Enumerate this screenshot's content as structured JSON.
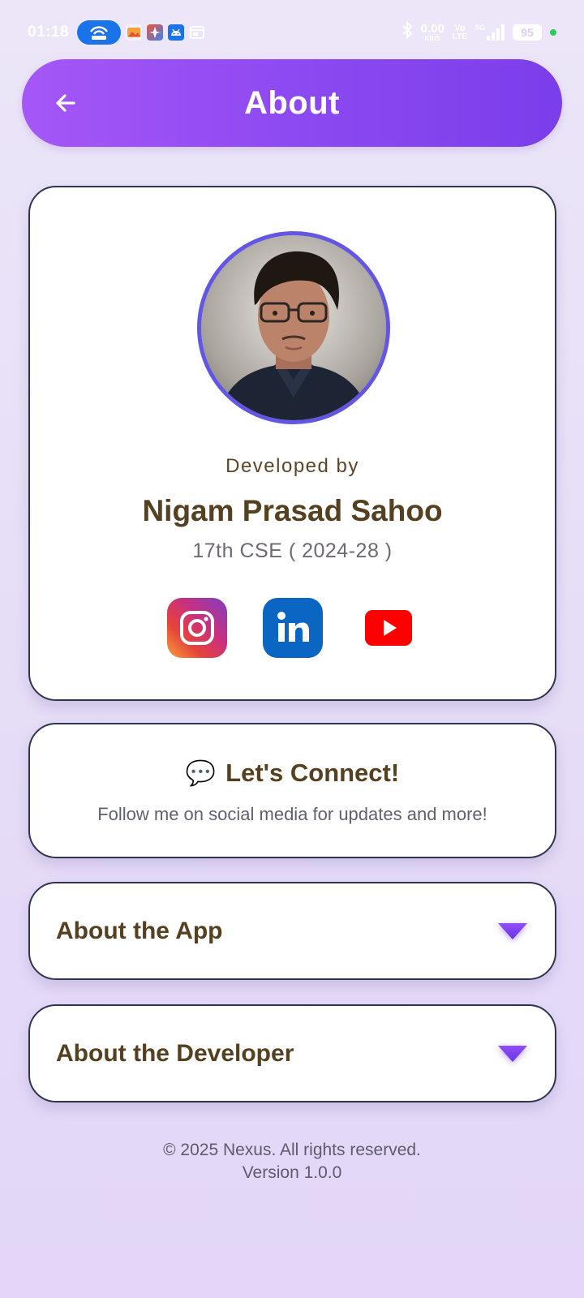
{
  "status_bar": {
    "time": "01:18",
    "net_speed": "0.00",
    "net_unit": "KB/S",
    "volte_top": "Vo",
    "volte_bottom": "LTE",
    "network": "5G",
    "battery": "95"
  },
  "header": {
    "title": "About"
  },
  "profile": {
    "developed_by": "Developed by",
    "name": "Nigam Prasad Sahoo",
    "batch": "17th CSE ( 2024-28 )"
  },
  "socials": [
    {
      "name": "instagram-icon"
    },
    {
      "name": "linkedin-icon"
    },
    {
      "name": "youtube-icon"
    }
  ],
  "connect": {
    "emoji": "💬",
    "title": "Let's Connect!",
    "subtitle": "Follow me on social media for updates and more!"
  },
  "accordions": {
    "about_app": "About the App",
    "about_developer": "About the Developer"
  },
  "footer": {
    "copyright": "© 2025 Nexus. All rights reserved.",
    "version": "Version 1.0.0"
  },
  "colors": {
    "header_gradient_start": "#a557f7",
    "header_gradient_end": "#7a3eea",
    "avatar_ring": "#6356e5",
    "heading_brown": "#55401f",
    "accent_purple": "#7b3ff2"
  }
}
